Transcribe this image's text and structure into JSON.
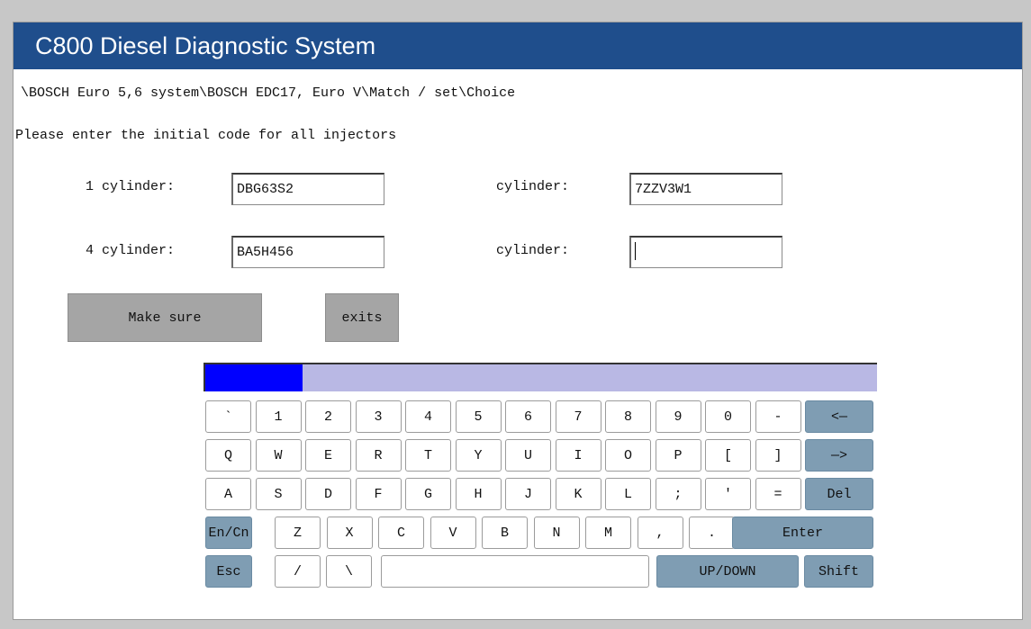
{
  "window": {
    "title": "C800 Diesel Diagnostic System",
    "breadcrumb": "\\BOSCH Euro 5,6 system\\BOSCH EDC17, Euro V\\Match / set\\Choice",
    "instruction": "Please enter the initial code for all injectors"
  },
  "fields": {
    "row1_left_label": "1 cylinder:",
    "row1_left_value": "DBG63S2",
    "row1_right_label": "cylinder:",
    "row1_right_value": "7ZZV3W1",
    "row2_left_label": "4 cylinder:",
    "row2_left_value": "BA5H456",
    "row2_right_label": "cylinder:",
    "row2_right_value": ""
  },
  "buttons": {
    "make_sure": "Make sure",
    "exits": "exits"
  },
  "keyboard": {
    "row1": [
      "`",
      "1",
      "2",
      "3",
      "4",
      "5",
      "6",
      "7",
      "8",
      "9",
      "0",
      "-"
    ],
    "backspace": "<—",
    "row2": [
      "Q",
      "W",
      "E",
      "R",
      "T",
      "Y",
      "U",
      "I",
      "O",
      "P",
      "[",
      "]"
    ],
    "tab": "—>",
    "row3": [
      "A",
      "S",
      "D",
      "F",
      "G",
      "H",
      "J",
      "K",
      "L",
      ";",
      "'",
      "="
    ],
    "del": "Del",
    "en_cn": "En/Cn",
    "row4": [
      "Z",
      "X",
      "C",
      "V",
      "B",
      "N",
      "M",
      ",",
      "."
    ],
    "enter": "Enter",
    "esc": "Esc",
    "slash": "/",
    "backslash": "\\",
    "space": "",
    "up_down": "UP/DOWN",
    "shift": "Shift"
  },
  "colors": {
    "titlebar": "#1f4e8c",
    "special_key": "#7f9db3",
    "kb_bar": "#b9b8e4",
    "kb_selection": "#0000ff"
  }
}
